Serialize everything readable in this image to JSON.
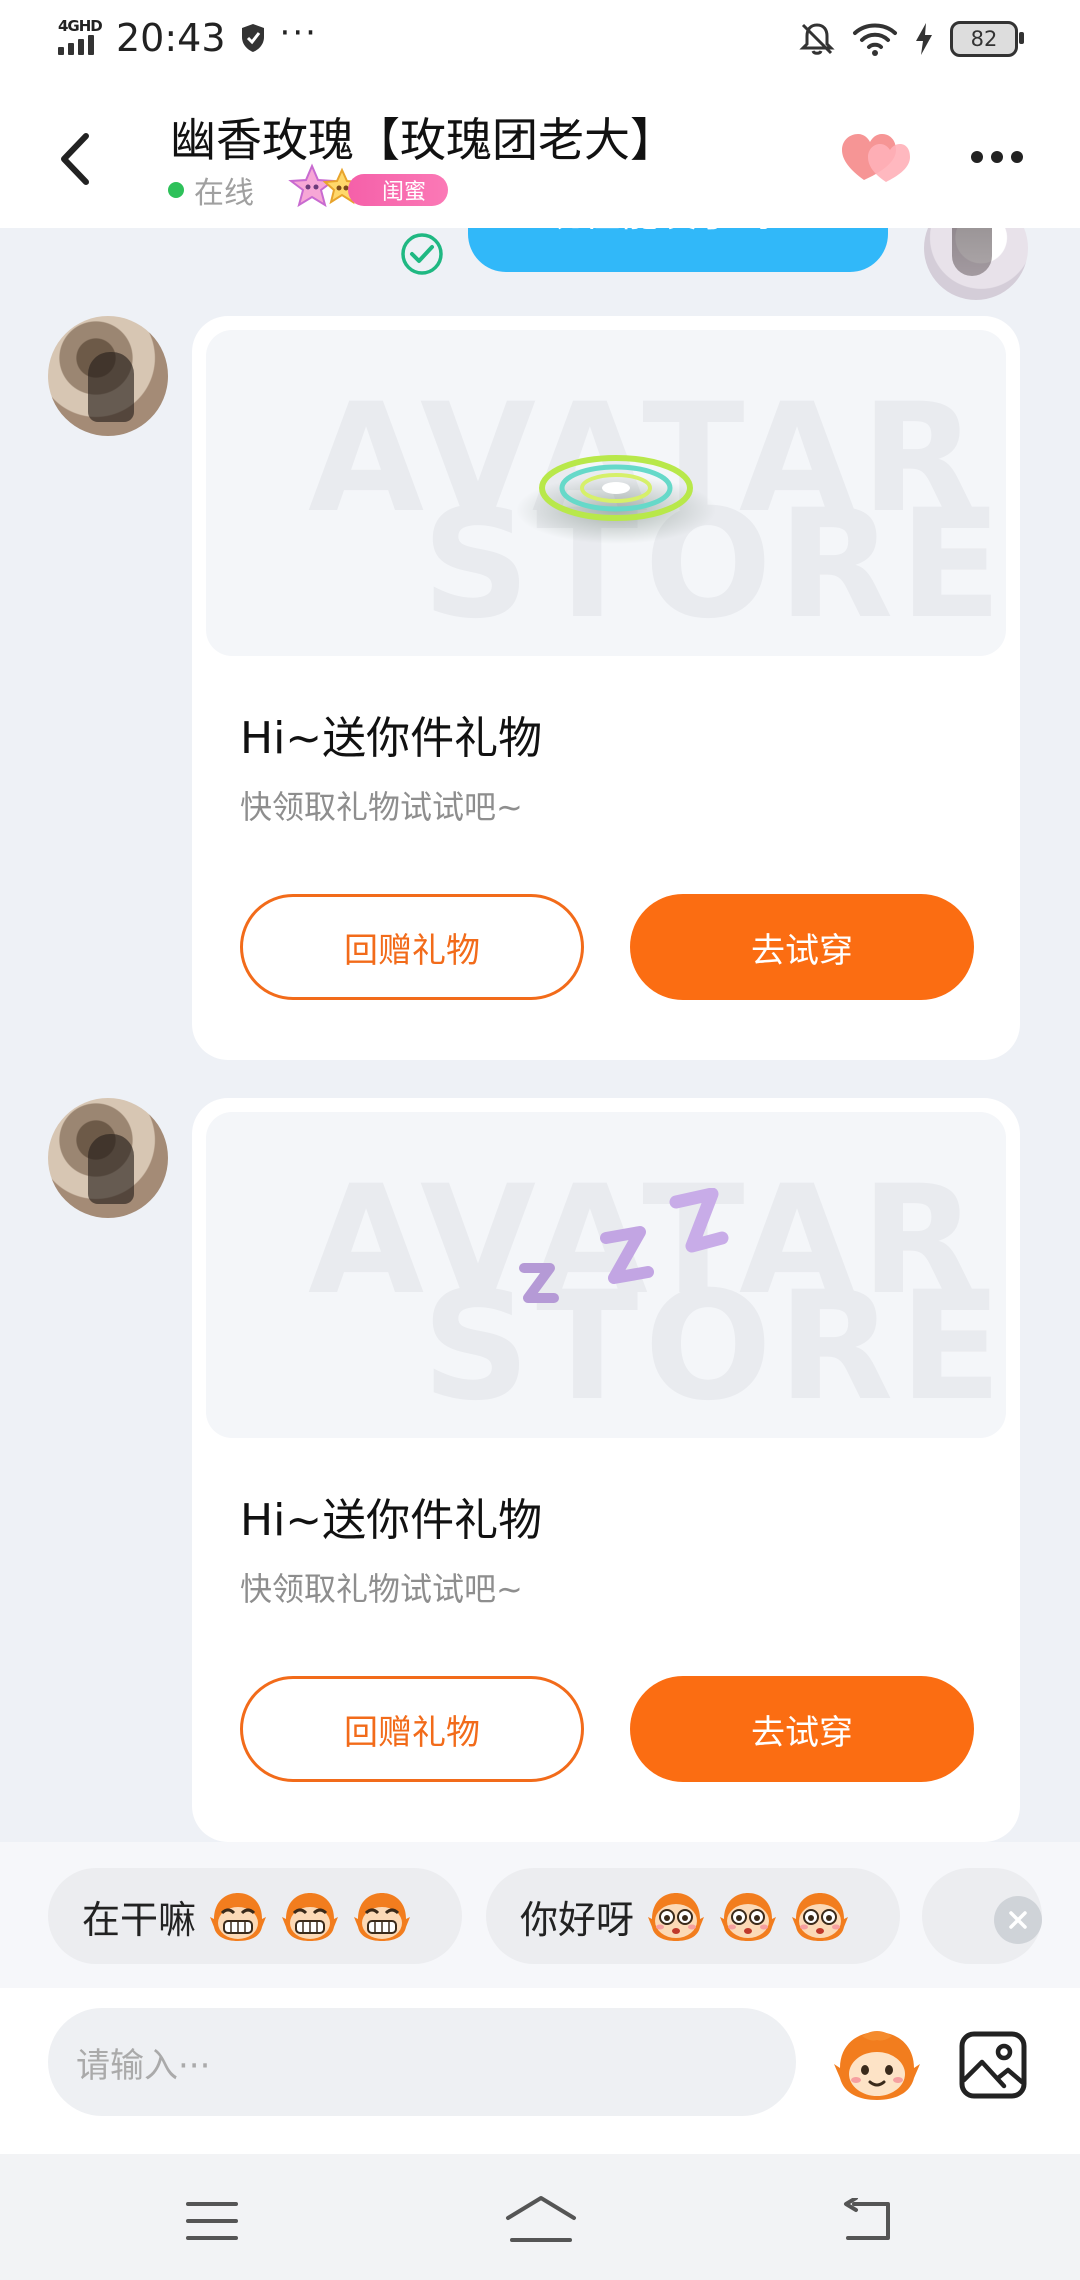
{
  "status_bar": {
    "network": "4GHD",
    "time": "20:43",
    "more": "···",
    "battery": "82"
  },
  "header": {
    "title": "幽香玫瑰【玫瑰团老大】",
    "online_status": "在线",
    "badge": "闺蜜",
    "online_color": "#2ec15a"
  },
  "chat": {
    "sent_message": "现在能发了吗？",
    "sent_bubble_color": "#31b8f9",
    "messages": [
      {
        "gift_title": "Hi~送你件礼物",
        "gift_subtitle": "快领取礼物试试吧~",
        "watermark_line1": "AVATAR",
        "watermark_line2": "STORE",
        "return_button": "回赠礼物",
        "try_button": "去试穿"
      },
      {
        "gift_title": "Hi~送你件礼物",
        "gift_subtitle": "快领取礼物试试吧~",
        "watermark_line1": "AVATAR",
        "watermark_line2": "STORE",
        "return_button": "回赠礼物",
        "try_button": "去试穿"
      }
    ],
    "accent_color": "#fb6d12"
  },
  "quick_replies": [
    {
      "text": "在干嘛",
      "emoji": "grinning-monkey-icon"
    },
    {
      "text": "你好呀",
      "emoji": "wide-eyed-monkey-icon"
    }
  ],
  "input": {
    "placeholder": "请输入···"
  }
}
